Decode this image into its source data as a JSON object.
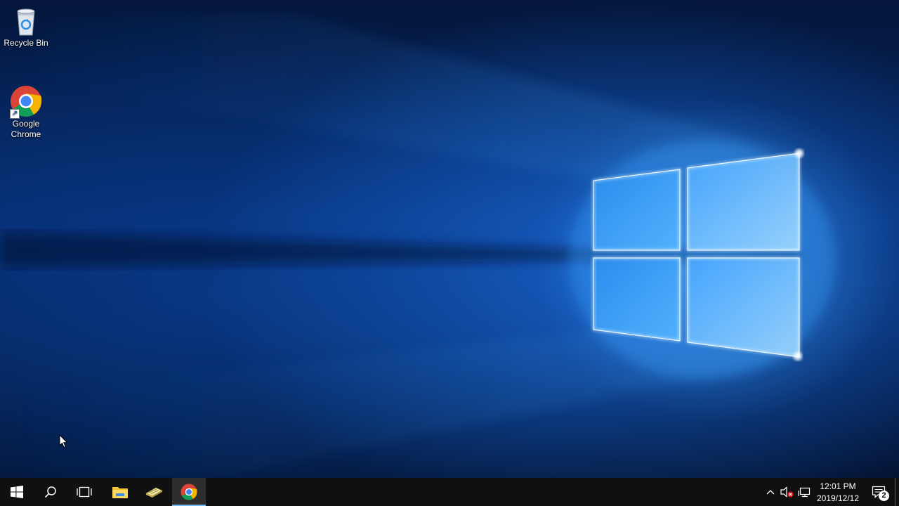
{
  "desktop": {
    "icons": [
      {
        "label": "Recycle Bin",
        "icon": "recycle-bin-icon"
      },
      {
        "label": "Google\nChrome",
        "icon": "chrome-icon"
      }
    ]
  },
  "taskbar": {
    "start": "windows-logo-icon",
    "search": "search-icon",
    "task_view": "task-view-icon",
    "pinned": [
      {
        "name": "file-explorer",
        "icon": "folder-icon"
      },
      {
        "name": "notepad-app",
        "icon": "notepad-icon"
      },
      {
        "name": "google-chrome",
        "icon": "chrome-icon",
        "active": true
      }
    ],
    "tray": {
      "show_hidden": "chevron-up-icon",
      "volume": "volume-muted-icon",
      "network": "network-icon",
      "time": "12:01 PM",
      "date": "2019/12/12",
      "notifications": "2"
    }
  },
  "colors": {
    "taskbar": "#101010",
    "active_indicator": "#76b9ed",
    "wallpaper_dark": "#04163a",
    "wallpaper_glow": "#46aaff"
  }
}
